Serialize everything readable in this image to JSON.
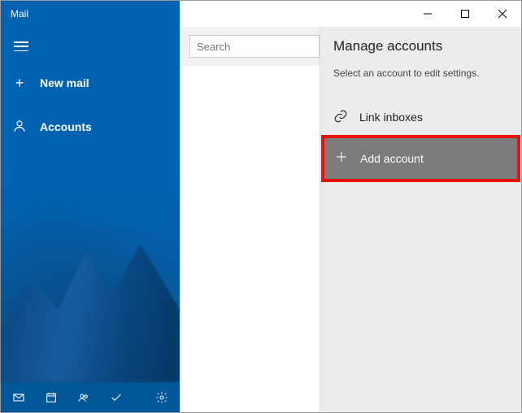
{
  "titlebar": {
    "app_title": "Mail"
  },
  "sidebar": {
    "new_mail_label": "New mail",
    "accounts_label": "Accounts"
  },
  "search": {
    "placeholder": "Search"
  },
  "panel": {
    "title": "Manage accounts",
    "subtitle": "Select an account to edit settings.",
    "link_inboxes_label": "Link inboxes",
    "add_account_label": "Add account"
  }
}
